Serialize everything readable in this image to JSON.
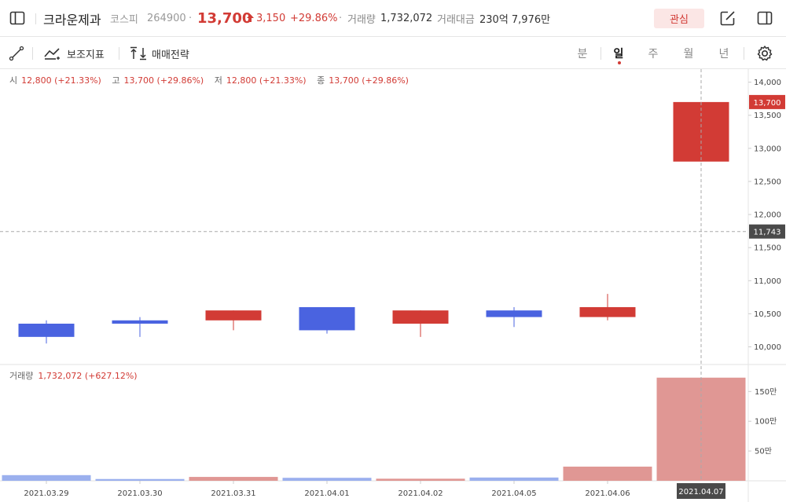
{
  "header": {
    "name": "크라운제과",
    "market": "코스피",
    "code": "264900",
    "price": "13,700",
    "change": "3,150",
    "change_pct": "+29.86%",
    "volume_label": "거래량",
    "volume": "1,732,072",
    "amount_label": "거래대금",
    "amount": "230억 7,976만",
    "fav_label": "관심",
    "up_color": "#d23b35",
    "down_color": "#4a63e0"
  },
  "toolbar": {
    "indicator_label": "보조지표",
    "strategy_label": "매매전략",
    "periods": [
      "분",
      "일",
      "주",
      "월",
      "년"
    ],
    "active_period": "일"
  },
  "ohlc": {
    "open_label": "시",
    "open": "12,800 (+21.33%)",
    "high_label": "고",
    "high": "13,700 (+29.86%)",
    "low_label": "저",
    "low": "12,800 (+21.33%)",
    "close_label": "종",
    "close": "13,700 (+29.86%)"
  },
  "volume_legend": {
    "label": "거래량",
    "value": "1,732,072 (+627.12%)"
  },
  "chart_data": {
    "type": "candlestick",
    "dates": [
      "2021.03.29",
      "2021.03.30",
      "2021.03.31",
      "2021.04.01",
      "2021.04.02",
      "2021.04.05",
      "2021.04.06",
      "2021.04.07"
    ],
    "candles": [
      {
        "o": 10350,
        "h": 10400,
        "l": 10050,
        "c": 10150
      },
      {
        "o": 10400,
        "h": 10450,
        "l": 10150,
        "c": 10350
      },
      {
        "o": 10400,
        "h": 10550,
        "l": 10250,
        "c": 10550
      },
      {
        "o": 10600,
        "h": 10600,
        "l": 10200,
        "c": 10250
      },
      {
        "o": 10350,
        "h": 10550,
        "l": 10150,
        "c": 10550
      },
      {
        "o": 10550,
        "h": 10600,
        "l": 10300,
        "c": 10450
      },
      {
        "o": 10450,
        "h": 10800,
        "l": 10400,
        "c": 10600
      },
      {
        "o": 12800,
        "h": 13700,
        "l": 12800,
        "c": 13700
      }
    ],
    "price_ticks": [
      "10,000",
      "10,500",
      "11,000",
      "11,500",
      "12,000",
      "12,500",
      "13,000",
      "13,500",
      "14,000"
    ],
    "price_tick_values": [
      10000,
      10500,
      11000,
      11500,
      12000,
      12500,
      13000,
      13500,
      14000
    ],
    "price_range": [
      9780,
      14150
    ],
    "volumes": [
      95000,
      30000,
      65000,
      50000,
      35000,
      55000,
      238000,
      1732072
    ],
    "volume_ticks": [
      "50만",
      "100만",
      "150만"
    ],
    "volume_tick_values": [
      500000,
      1000000,
      1500000
    ],
    "volume_range": [
      0,
      1900000
    ],
    "last_price_label": "13,700",
    "last_price": 13700,
    "crosshair_price_label": "11,743",
    "crosshair_price": 11743,
    "crosshair_date": "2021.04.07"
  }
}
